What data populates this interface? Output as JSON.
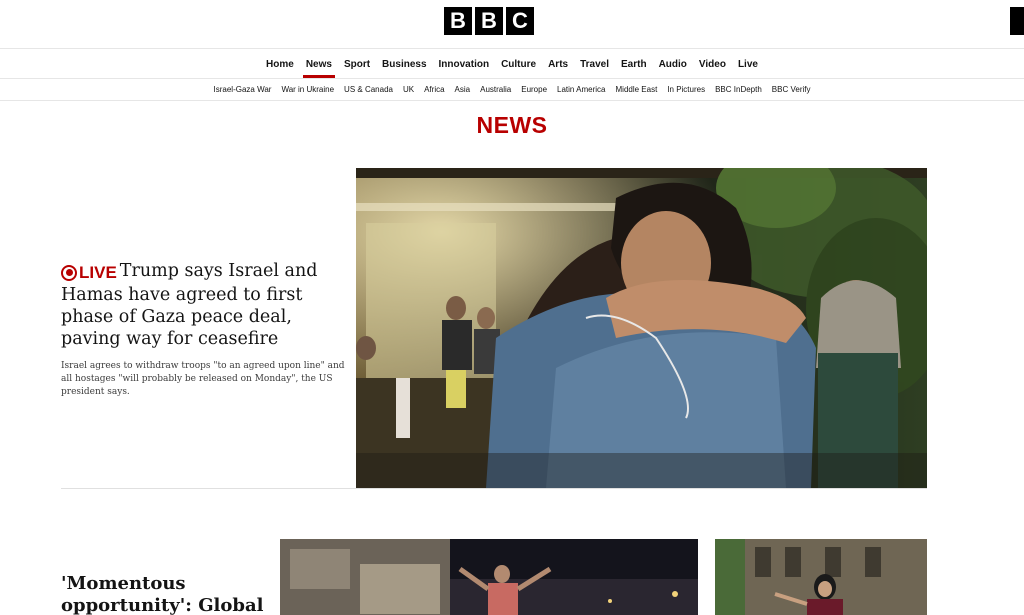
{
  "brand": {
    "logo_letters": [
      "B",
      "B",
      "C"
    ]
  },
  "primary_nav": [
    "Home",
    "News",
    "Sport",
    "Business",
    "Innovation",
    "Culture",
    "Arts",
    "Travel",
    "Earth",
    "Audio",
    "Video",
    "Live"
  ],
  "primary_nav_active": "News",
  "secondary_nav": [
    "Israel-Gaza War",
    "War in Ukraine",
    "US & Canada",
    "UK",
    "Africa",
    "Asia",
    "Australia",
    "Europe",
    "Latin America",
    "Middle East",
    "In Pictures",
    "BBC InDepth",
    "BBC Verify"
  ],
  "section_title": "NEWS",
  "lead_story": {
    "live_label": "LIVE",
    "headline": "Trump says Israel and Hamas have agreed to first phase of Gaza peace deal, paving way for ceasefire",
    "summary": "Israel agrees to withdraw troops \"to an agreed upon line\" and all hostages \"will probably be released on Monday\", the US president says.",
    "image_icon": "photo-embrace"
  },
  "second_story": {
    "headline": "'Momentous opportunity': Global"
  },
  "colors": {
    "accent": "#b80000",
    "text": "#141414",
    "logo": "#000000"
  }
}
